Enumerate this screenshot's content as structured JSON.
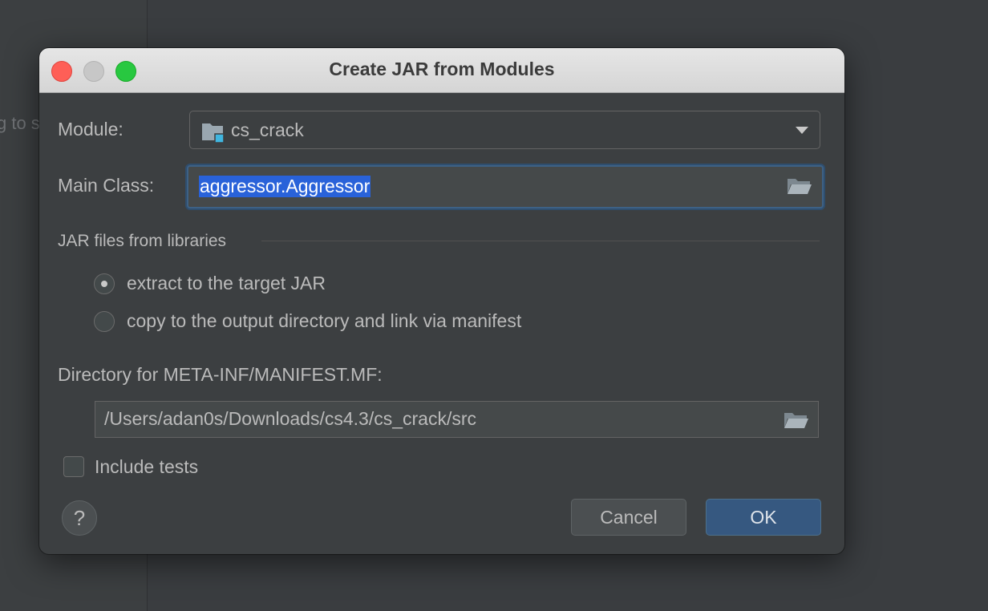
{
  "background": {
    "hint_text": "g to s"
  },
  "dialog": {
    "title": "Create JAR from Modules",
    "module_label": "Module:",
    "module_value": "cs_crack",
    "main_class_label": "Main Class:",
    "main_class_value": "aggressor.Aggressor",
    "libraries_section_title": "JAR files from libraries",
    "radio_options": [
      {
        "label": "extract to the target JAR",
        "selected": true
      },
      {
        "label": "copy to the output directory and link via manifest",
        "selected": false
      }
    ],
    "manifest_dir_label": "Directory for META-INF/MANIFEST.MF:",
    "manifest_dir_value": "/Users/adan0s/Downloads/cs4.3/cs_crack/src",
    "include_tests_label": "Include tests",
    "include_tests_checked": false,
    "help_label": "?",
    "cancel_label": "Cancel",
    "ok_label": "OK"
  },
  "colors": {
    "selection": "#2962d9",
    "ok_button": "#365880",
    "focus_ring": "#3d6185",
    "close": "#fe5f57",
    "maximize": "#28c840"
  },
  "icons": [
    "folder-module-icon",
    "chevron-down-icon",
    "folder-open-icon",
    "help-icon"
  ]
}
